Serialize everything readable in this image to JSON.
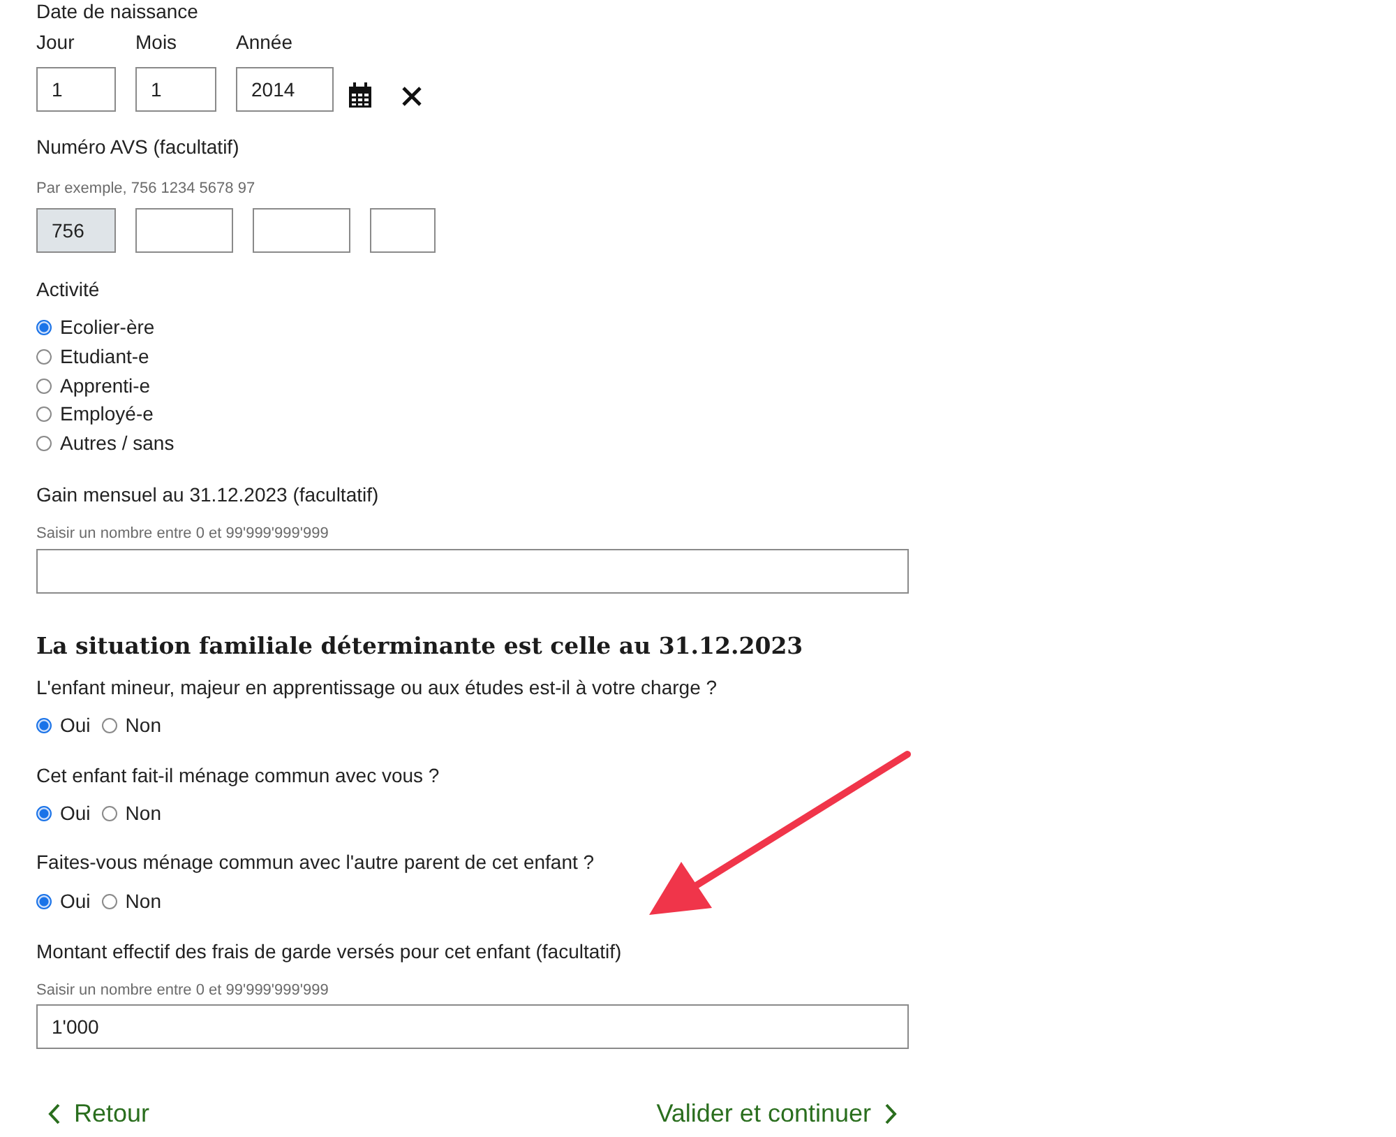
{
  "birth_date": {
    "label": "Date de naissance",
    "fields": [
      {
        "label": "Jour",
        "value": "1"
      },
      {
        "label": "Mois",
        "value": "1"
      },
      {
        "label": "Année",
        "value": "2014"
      }
    ]
  },
  "avs": {
    "label": "Numéro AVS (facultatif)",
    "hint": "Par exemple, 756 1234 5678 97",
    "fields": [
      {
        "value": "756",
        "disabled": true
      },
      {
        "disabled": false
      },
      {
        "disabled": false
      },
      {
        "disabled": false
      }
    ]
  },
  "activity": {
    "label": "Activité",
    "options": [
      {
        "label": "Ecolier-ère",
        "selected": true
      },
      {
        "label": "Etudiant-e",
        "selected": false
      },
      {
        "label": "Apprenti-e",
        "selected": false
      },
      {
        "label": "Employé-e",
        "selected": false
      },
      {
        "label": "Autres / sans",
        "selected": false
      }
    ]
  },
  "income": {
    "label": "Gain mensuel au 31.12.2023 (facultatif)",
    "hint": "Saisir un nombre entre 0 et 99'999'999'999"
  },
  "section_title": "La situation familiale déterminante est celle au 31.12.2023",
  "questions": [
    {
      "label": "L'enfant mineur, majeur en apprentissage ou aux études est-il à votre charge ?",
      "options": [
        {
          "label": "Oui",
          "selected": true
        },
        {
          "label": "Non",
          "selected": false
        }
      ]
    },
    {
      "label": "Cet enfant fait-il ménage commun avec vous ?",
      "options": [
        {
          "label": "Oui",
          "selected": true
        },
        {
          "label": "Non",
          "selected": false
        }
      ]
    },
    {
      "label": "Faites-vous ménage commun avec l'autre parent de cet enfant ?",
      "options": [
        {
          "label": "Oui",
          "selected": true
        },
        {
          "label": "Non",
          "selected": false
        }
      ]
    }
  ],
  "childcare": {
    "label": "Montant effectif des frais de garde versés pour cet enfant (facultatif)",
    "hint": "Saisir un nombre entre 0 et 99'999'999'999",
    "value": "1'000"
  },
  "navigation": {
    "back": "Retour",
    "next": "Valider et continuer"
  }
}
